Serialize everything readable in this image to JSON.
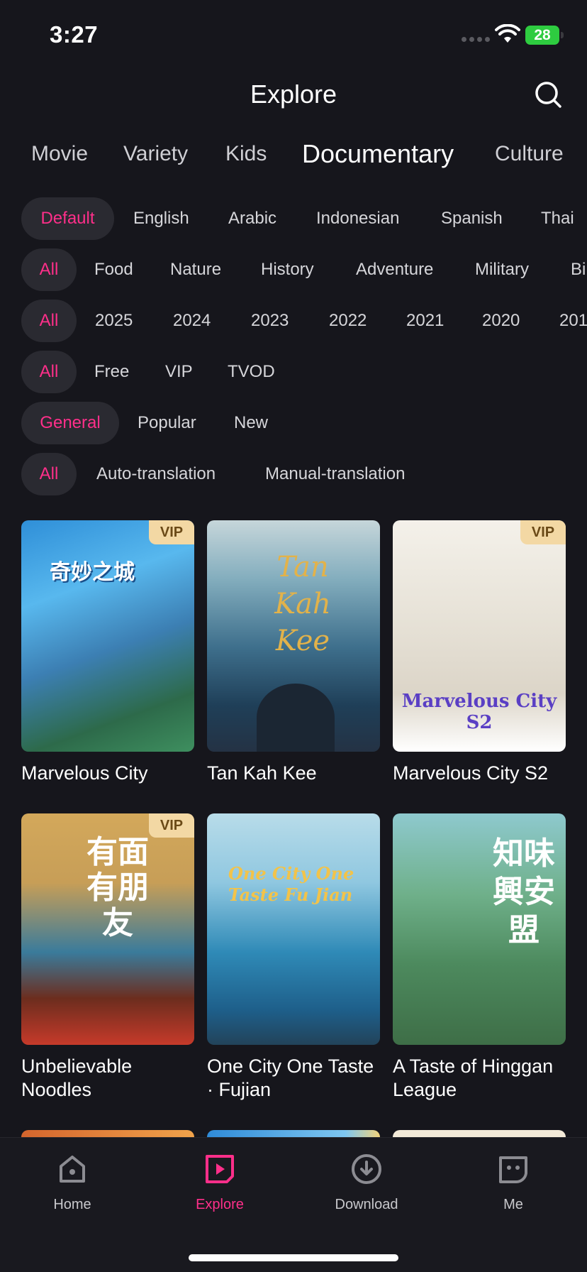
{
  "status_bar": {
    "time": "3:27",
    "battery": "28"
  },
  "header": {
    "title": "Explore"
  },
  "categories": [
    "Movie",
    "Variety",
    "Kids",
    "Documentary",
    "Culture"
  ],
  "active_category": "Documentary",
  "filters": {
    "language": [
      "Default",
      "English",
      "Arabic",
      "Indonesian",
      "Spanish",
      "Thai"
    ],
    "genre": [
      "All",
      "Food",
      "Nature",
      "History",
      "Adventure",
      "Military",
      "Bi"
    ],
    "year": [
      "All",
      "2025",
      "2024",
      "2023",
      "2022",
      "2021",
      "2020",
      "201"
    ],
    "pay": [
      "All",
      "Free",
      "VIP",
      "TVOD"
    ],
    "sort": [
      "General",
      "Popular",
      "New"
    ],
    "translation": [
      "All",
      "Auto-translation",
      "Manual-translation"
    ]
  },
  "badge_label": "VIP",
  "posters": [
    {
      "title": "Marvelous City",
      "vip": true,
      "art_text": "奇妙之城"
    },
    {
      "title": "Tan Kah Kee",
      "vip": false,
      "art_text": "Tan Kah Kee"
    },
    {
      "title": "Marvelous City S2",
      "vip": true,
      "art_text": "Marvelous City S2"
    },
    {
      "title": "Unbelievable Noodles",
      "vip": true,
      "art_text": "有面有朋友"
    },
    {
      "title": "One City One Taste · Fujian",
      "vip": false,
      "art_text": "One City One Taste Fu Jian"
    },
    {
      "title": "A Taste of Hinggan League",
      "vip": false,
      "art_text": "知味 興安盟"
    }
  ],
  "tabbar": {
    "home": "Home",
    "explore": "Explore",
    "download": "Download",
    "me": "Me"
  }
}
